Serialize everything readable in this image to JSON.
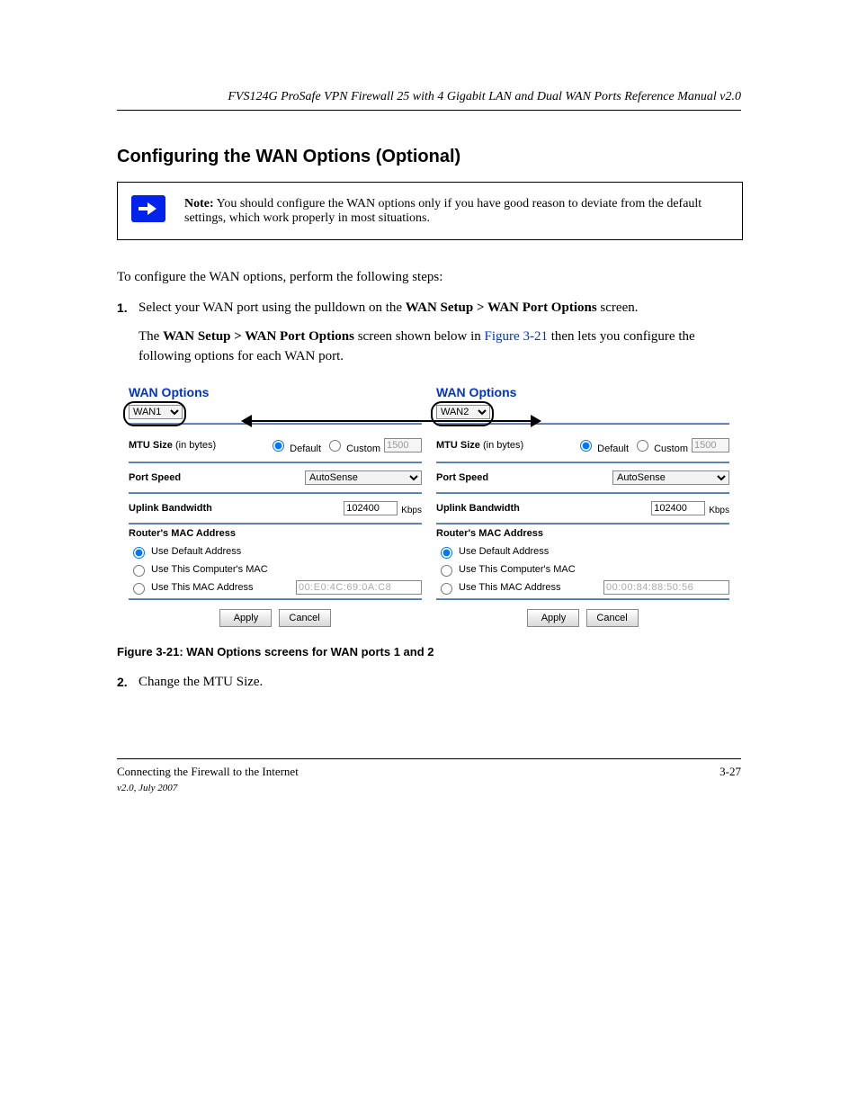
{
  "header": "FVS124G ProSafe VPN Firewall 25 with 4 Gigabit LAN and Dual WAN Ports Reference Manual v2.0",
  "section_title": "Configuring the WAN Options (Optional)",
  "note": {
    "label": "Note:",
    "text": " You should configure the WAN options only if you have good reason to deviate from the default settings, which work properly in most situations."
  },
  "intro": "To configure the WAN options, perform the following steps:",
  "step1": {
    "num": "1.",
    "prefix": "Select your WAN port using the pulldown on the ",
    "strong": "WAN Setup > WAN Port Options",
    "suffix": " screen."
  },
  "pretty_panel": {
    "lead": "The ",
    "strong": "WAN Setup > WAN Port Options",
    "tail1": " screen shown below in ",
    "figref": "Figure 3-21",
    "tail2": " then lets you configure the following options for each WAN port."
  },
  "panel": {
    "wan1": {
      "title": "WAN Options",
      "select_value": "WAN1",
      "mtu_label": "MTU Size (in bytes)",
      "mtu_default": "Default",
      "mtu_custom": "Custom",
      "mtu_val": "1500",
      "port_label": "Port Speed",
      "port_val": "AutoSense",
      "uplink_label": "Uplink Bandwidth",
      "uplink_val": "102400",
      "kbps": "Kbps",
      "mac_header": "Router's MAC Address",
      "opt_default": "Use Default Address",
      "opt_comp": "Use This Computer's MAC",
      "opt_this": "Use This MAC Address",
      "mac_val": "00:E0:4C:69:0A:C8",
      "apply": "Apply",
      "cancel": "Cancel"
    },
    "wan2": {
      "title": "WAN Options",
      "select_value": "WAN2",
      "mtu_label": "MTU Size (in bytes)",
      "mtu_default": "Default",
      "mtu_custom": "Custom",
      "mtu_val": "1500",
      "port_label": "Port Speed",
      "port_val": "AutoSense",
      "uplink_label": "Uplink Bandwidth",
      "uplink_val": "102400",
      "kbps": "Kbps",
      "mac_header": "Router's MAC Address",
      "opt_default": "Use Default Address",
      "opt_comp": "Use This Computer's MAC",
      "opt_this": "Use This MAC Address",
      "mac_val": "00:00:84:88:50:56",
      "apply": "Apply",
      "cancel": "Cancel"
    }
  },
  "figure_caption": "Figure 3-21:  WAN Options screens for WAN ports 1 and 2",
  "step2": {
    "num": "2.",
    "text": "Change the MTU Size."
  },
  "footer": {
    "left": "Connecting the Firewall to the Internet",
    "right": "3-27",
    "version": "v2.0, July 2007"
  }
}
